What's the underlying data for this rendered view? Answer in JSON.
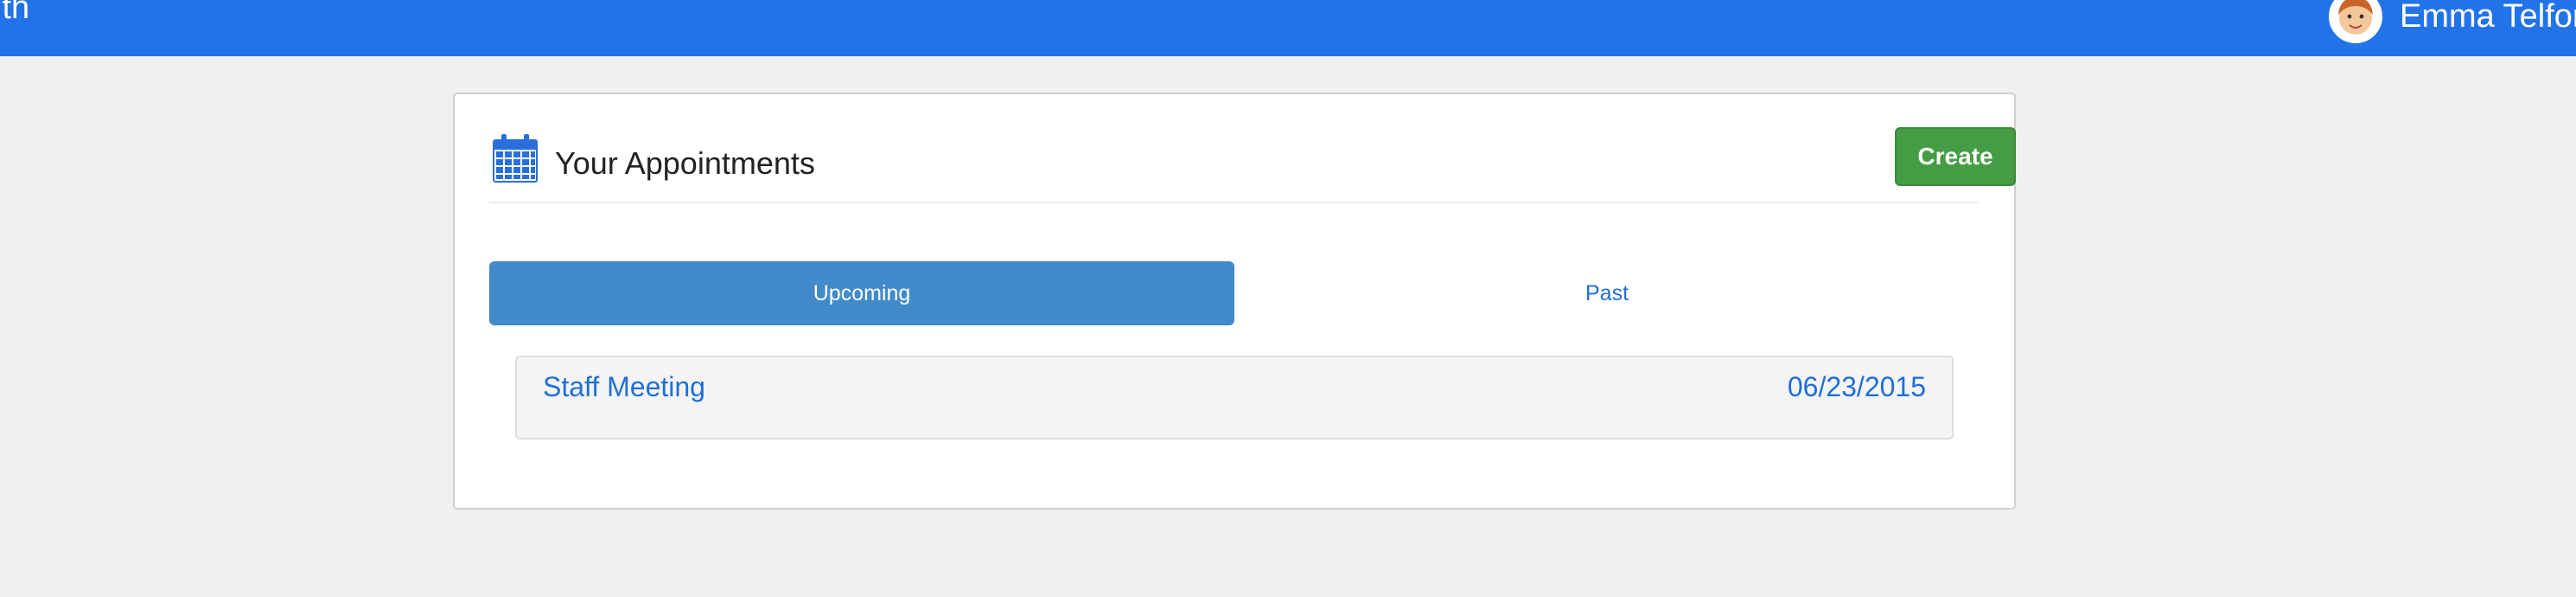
{
  "header": {
    "brand_text": "lth",
    "user_name": "Emma Telfor"
  },
  "appointments": {
    "title": "Your Appointments",
    "create_label": "Create",
    "tabs": [
      {
        "label": "Upcoming",
        "active": true
      },
      {
        "label": "Past",
        "active": false
      }
    ],
    "items": [
      {
        "title": "Staff Meeting",
        "date": "06/23/2015"
      }
    ]
  },
  "colors": {
    "topbar": "#2373e8",
    "create_button": "#449d44",
    "active_tab": "#428bca",
    "link": "#1f6fd8"
  },
  "icons": {
    "panel": "calendar-icon",
    "user": "avatar"
  }
}
